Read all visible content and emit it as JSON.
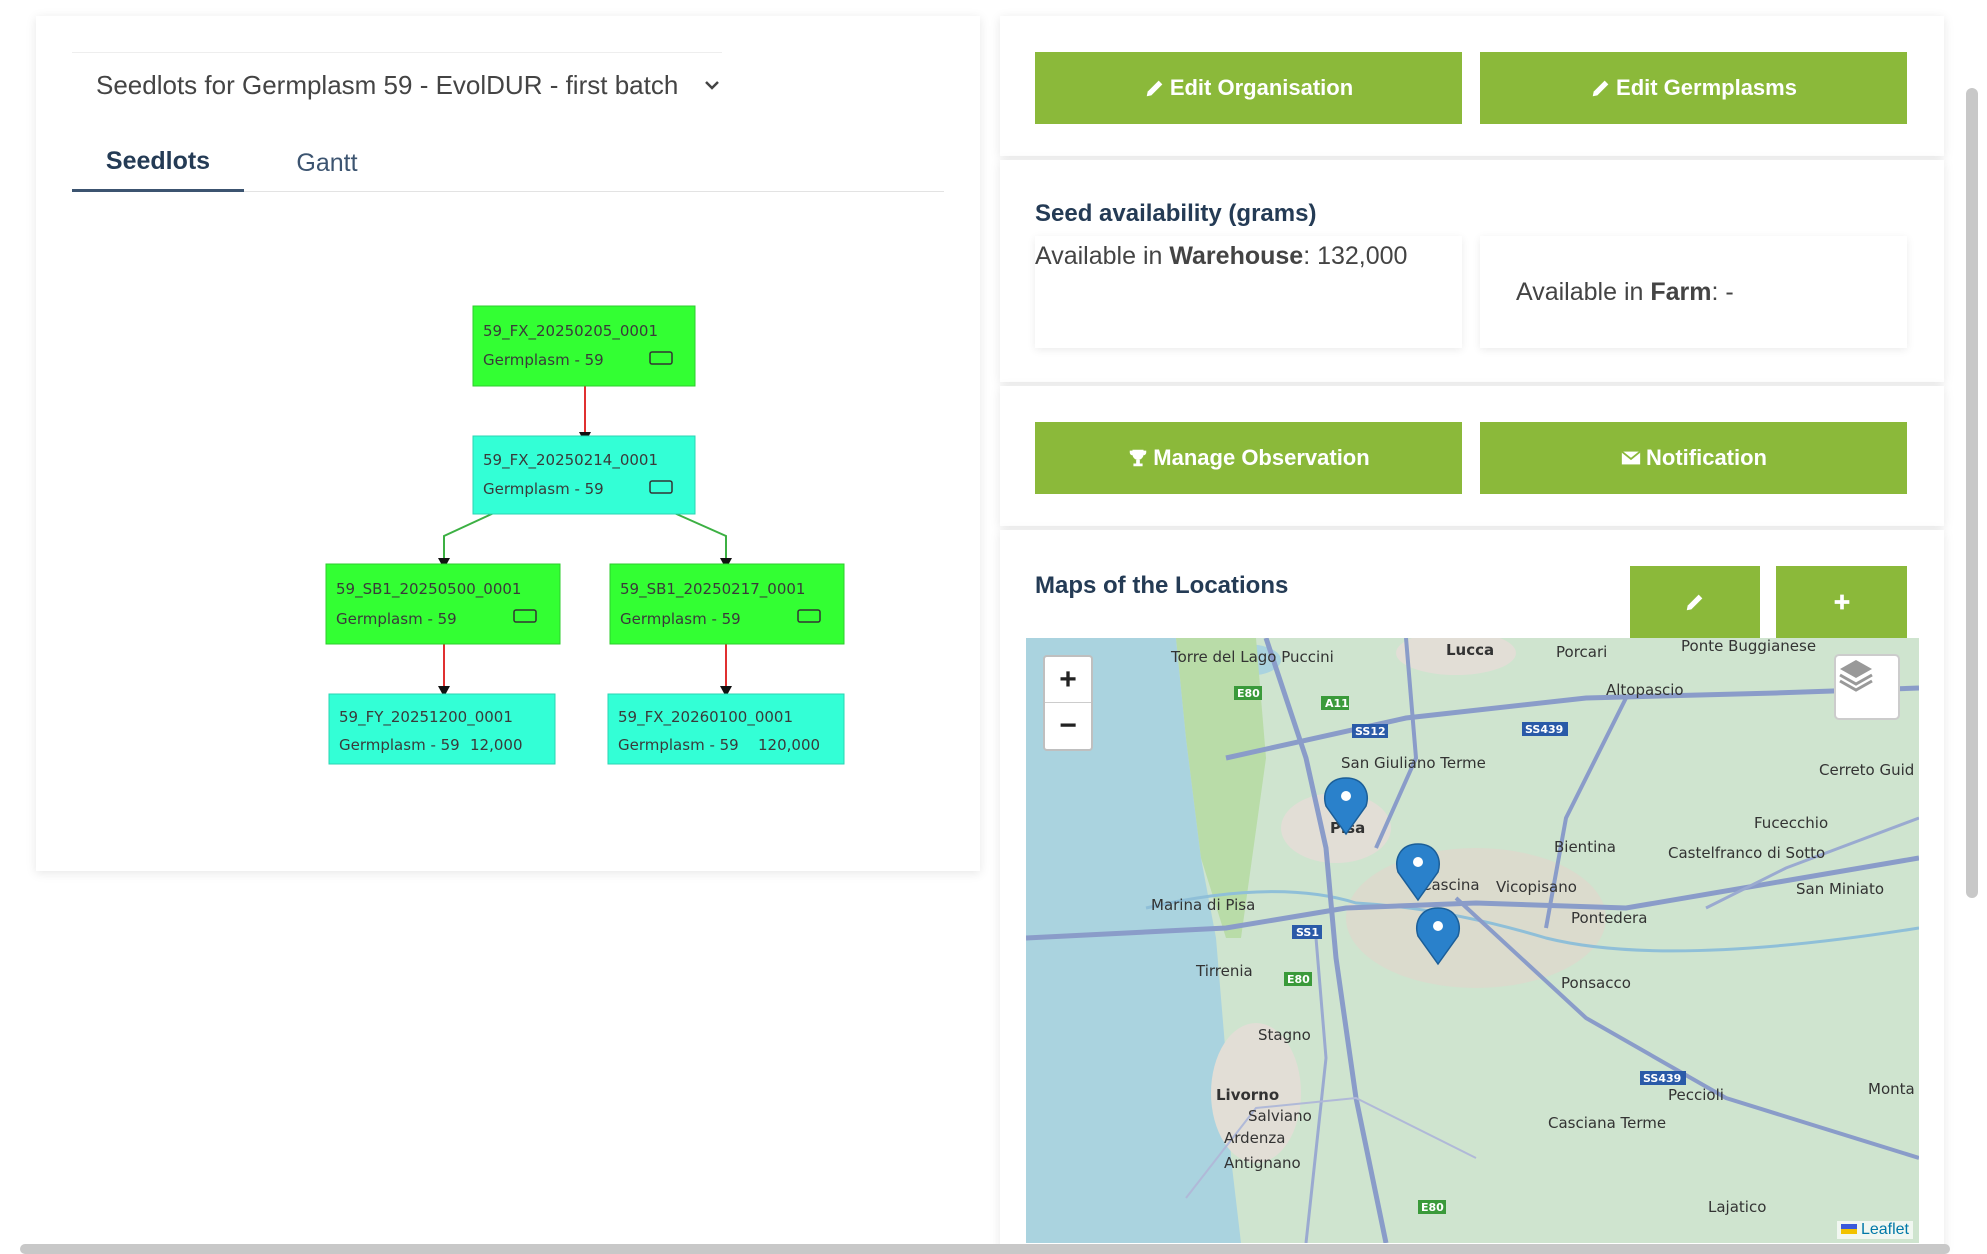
{
  "selector": {
    "label": "Seedlots for Germplasm 59 - EvolDUR - first batch"
  },
  "tabs": [
    {
      "label": "Seedlots"
    },
    {
      "label": "Gantt"
    }
  ],
  "tree": {
    "nodes": [
      {
        "id": "59_FX_20250205_0001",
        "sub": "Germplasm - 59",
        "qty": "",
        "color": "#33ff33"
      },
      {
        "id": "59_FX_20250214_0001",
        "sub": "Germplasm - 59",
        "qty": "",
        "color": "#33ffd6"
      },
      {
        "id": "59_SB1_20250500_0001",
        "sub": "Germplasm - 59",
        "qty": "",
        "color": "#33ff33"
      },
      {
        "id": "59_SB1_20250217_0001",
        "sub": "Germplasm - 59",
        "qty": "",
        "color": "#33ff33"
      },
      {
        "id": "59_FY_20251200_0001",
        "sub": "Germplasm - 59",
        "qty": "12,000",
        "color": "#33ffd6"
      },
      {
        "id": "59_FX_20260100_0001",
        "sub": "Germplasm - 59",
        "qty": "120,000",
        "color": "#33ffd6"
      }
    ],
    "edge_colors": {
      "red": "#e03030",
      "green": "#3cb043"
    }
  },
  "buttons": {
    "edit_organisation": "Edit Organisation",
    "edit_germplasms": "Edit Germplasms",
    "manage_observation": "Manage Observation",
    "notification": "Notification"
  },
  "seed_availability": {
    "title": "Seed availability (grams)",
    "warehouse_prefix": "Available in ",
    "warehouse_label": "Warehouse",
    "warehouse_value": ": 132,000",
    "farm_prefix": "Available in ",
    "farm_label": "Farm",
    "farm_value": ": -"
  },
  "map": {
    "title": "Maps of the Locations",
    "zoom_in": "+",
    "zoom_out": "−",
    "attribution": "Leaflet",
    "places": [
      "Lucca",
      "Porcari",
      "Ponte Buggianese",
      "Torre del Lago Puccini",
      "Altopascio",
      "San Giuliano Terme",
      "Cerreto Guid",
      "Pisa",
      "Fucecchio",
      "Bientina",
      "Castelfranco di Sotto",
      "Cascina",
      "Vicopisano",
      "San Miniato",
      "Marina di Pisa",
      "Pontedera",
      "Tirrenia",
      "Ponsacco",
      "Stagno",
      "Livorno",
      "Salviano",
      "Ardenza",
      "Antignano",
      "Peccioli",
      "Casciana Terme",
      "Lajatico",
      "Monta"
    ],
    "road_signs": [
      "E80",
      "A11",
      "SS12",
      "SS439",
      "SS1",
      "E80",
      "SS439",
      "E80"
    ],
    "colors": {
      "land": "#cfe4cf",
      "sea": "#aad3df",
      "road": "#8a9cc9",
      "marker": "#2a81cb"
    }
  },
  "colors": {
    "accent_green": "#8bb93a",
    "title_navy": "#243b55"
  }
}
